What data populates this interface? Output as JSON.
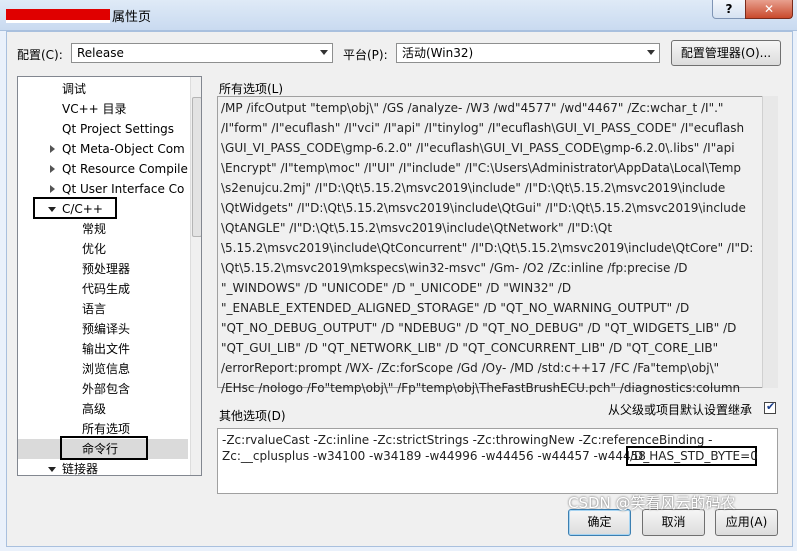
{
  "window": {
    "title": "属性页"
  },
  "toolbar": {
    "config_label": "配置(C):",
    "config_value": "Release",
    "platform_label": "平台(P):",
    "platform_value": "活动(Win32)",
    "config_manager_label": "配置管理器(O)..."
  },
  "tree": {
    "items": [
      {
        "label": "调试",
        "level": 1,
        "expander": "none"
      },
      {
        "label": "VC++ 目录",
        "level": 1,
        "expander": "none"
      },
      {
        "label": "Qt Project Settings",
        "level": 1,
        "expander": "none"
      },
      {
        "label": "Qt Meta-Object Com",
        "level": 1,
        "expander": "closed"
      },
      {
        "label": "Qt Resource Compile",
        "level": 1,
        "expander": "closed"
      },
      {
        "label": "Qt User Interface Co",
        "level": 1,
        "expander": "closed"
      },
      {
        "label": "C/C++",
        "level": 1,
        "expander": "open"
      },
      {
        "label": "常规",
        "level": 2,
        "expander": "none"
      },
      {
        "label": "优化",
        "level": 2,
        "expander": "none"
      },
      {
        "label": "预处理器",
        "level": 2,
        "expander": "none"
      },
      {
        "label": "代码生成",
        "level": 2,
        "expander": "none"
      },
      {
        "label": "语言",
        "level": 2,
        "expander": "none"
      },
      {
        "label": "预编译头",
        "level": 2,
        "expander": "none"
      },
      {
        "label": "输出文件",
        "level": 2,
        "expander": "none"
      },
      {
        "label": "浏览信息",
        "level": 2,
        "expander": "none"
      },
      {
        "label": "外部包含",
        "level": 2,
        "expander": "none"
      },
      {
        "label": "高级",
        "level": 2,
        "expander": "none"
      },
      {
        "label": "所有选项",
        "level": 2,
        "expander": "none"
      },
      {
        "label": "命令行",
        "level": 2,
        "expander": "none",
        "selected": true
      },
      {
        "label": "链接器",
        "level": 1,
        "expander": "open"
      }
    ]
  },
  "all_options": {
    "label": "所有选项(L)",
    "lines": [
      "/MP /ifcOutput \"temp\\obj\\\" /GS /analyze- /W3 /wd\"4577\" /wd\"4467\" /Zc:wchar_t /I\".\"",
      "/I\"form\" /I\"ecuflash\" /I\"vci\" /I\"api\" /I\"tinylog\" /I\"ecuflash\\GUI_VI_PASS_CODE\" /I\"ecuflash",
      "\\GUI_VI_PASS_CODE\\gmp-6.2.0\" /I\"ecuflash\\GUI_VI_PASS_CODE\\gmp-6.2.0\\.libs\" /I\"api",
      "\\Encrypt\" /I\"temp\\moc\" /I\"UI\" /I\"include\" /I\"C:\\Users\\Administrator\\AppData\\Local\\Temp",
      "\\s2enujcu.2mj\" /I\"D:\\Qt\\5.15.2\\msvc2019\\include\" /I\"D:\\Qt\\5.15.2\\msvc2019\\include",
      "\\QtWidgets\" /I\"D:\\Qt\\5.15.2\\msvc2019\\include\\QtGui\" /I\"D:\\Qt\\5.15.2\\msvc2019\\include",
      "\\QtANGLE\" /I\"D:\\Qt\\5.15.2\\msvc2019\\include\\QtNetwork\" /I\"D:\\Qt",
      "\\5.15.2\\msvc2019\\include\\QtConcurrent\" /I\"D:\\Qt\\5.15.2\\msvc2019\\include\\QtCore\" /I\"D:",
      "\\Qt\\5.15.2\\msvc2019\\mkspecs\\win32-msvc\" /Gm- /O2 /Zc:inline /fp:precise /D",
      "\"_WINDOWS\" /D \"UNICODE\" /D \"_UNICODE\" /D \"WIN32\" /D",
      "\"_ENABLE_EXTENDED_ALIGNED_STORAGE\" /D \"QT_NO_WARNING_OUTPUT\" /D",
      "\"QT_NO_DEBUG_OUTPUT\" /D \"NDEBUG\" /D \"QT_NO_DEBUG\" /D \"QT_WIDGETS_LIB\" /D",
      "\"QT_GUI_LIB\" /D \"QT_NETWORK_LIB\" /D \"QT_CONCURRENT_LIB\" /D \"QT_CORE_LIB\"",
      "/errorReport:prompt /WX- /Zc:forScope /Gd /Oy- /MD /std:c++17 /FC /Fa\"temp\\obj\\\"",
      "/EHsc /nologo /Fo\"temp\\obj\\\" /Fp\"temp\\obj\\TheFastBrushECU.pch\" /diagnostics:column"
    ]
  },
  "other_options": {
    "label": "其他选项(D)",
    "inherit_label": "从父级或项目默认设置继承",
    "inherit_checked": true,
    "line1": "-Zc:rvalueCast -Zc:inline -Zc:strictStrings -Zc:throwingNew -Zc:referenceBinding -",
    "line2": "Zc:__cplusplus -w34100 -w34189 -w44996 -w44456 -w44457 -w44458",
    "line2_highlight": "/D_HAS_STD_BYTE=0"
  },
  "buttons": {
    "ok": "确定",
    "cancel": "取消",
    "apply": "应用(A)"
  },
  "watermark": "CSDN @笑看风云的码农"
}
